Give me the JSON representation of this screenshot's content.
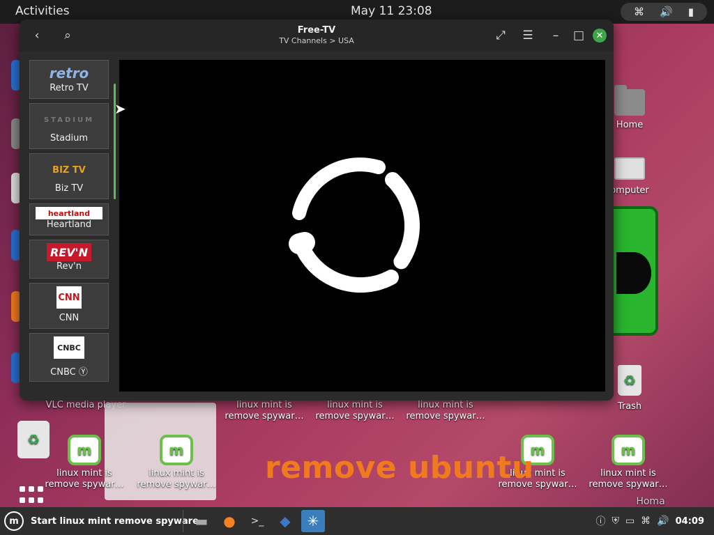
{
  "topbar": {
    "activities": "Activities",
    "clock": "May 11  23:08",
    "tray_icons": [
      "network-icon",
      "volume-icon",
      "battery-icon"
    ]
  },
  "desktop": {
    "home": "Home",
    "computer": "omputer",
    "trash": "Trash",
    "vlc": "VLC media player",
    "spyware_line1": "linux mint is",
    "spyware_line2": "remove spywar…",
    "remove_ubuntu": "remove ubuntu",
    "home_bottom": "Homa"
  },
  "window": {
    "title": "Free-TV",
    "subtitle": "TV Channels > USA",
    "channels": [
      {
        "name": "Retro TV",
        "logo": "retro"
      },
      {
        "name": "Stadium",
        "logo": "STADIUM"
      },
      {
        "name": "Biz TV",
        "logo": "BIZ TV"
      },
      {
        "name": "Heartland",
        "logo": "heartland"
      },
      {
        "name": "Rev'n",
        "logo": "REV'N"
      },
      {
        "name": "CNN",
        "logo": "CNN"
      },
      {
        "name": "CNBC Ⓨ",
        "logo": "CNBC"
      }
    ]
  },
  "taskbar": {
    "start_label": "Start linux mint remove spyware",
    "time": "04:09"
  },
  "colors": {
    "accent_green": "#3fa44a",
    "orange_text": "#f07a1e"
  }
}
